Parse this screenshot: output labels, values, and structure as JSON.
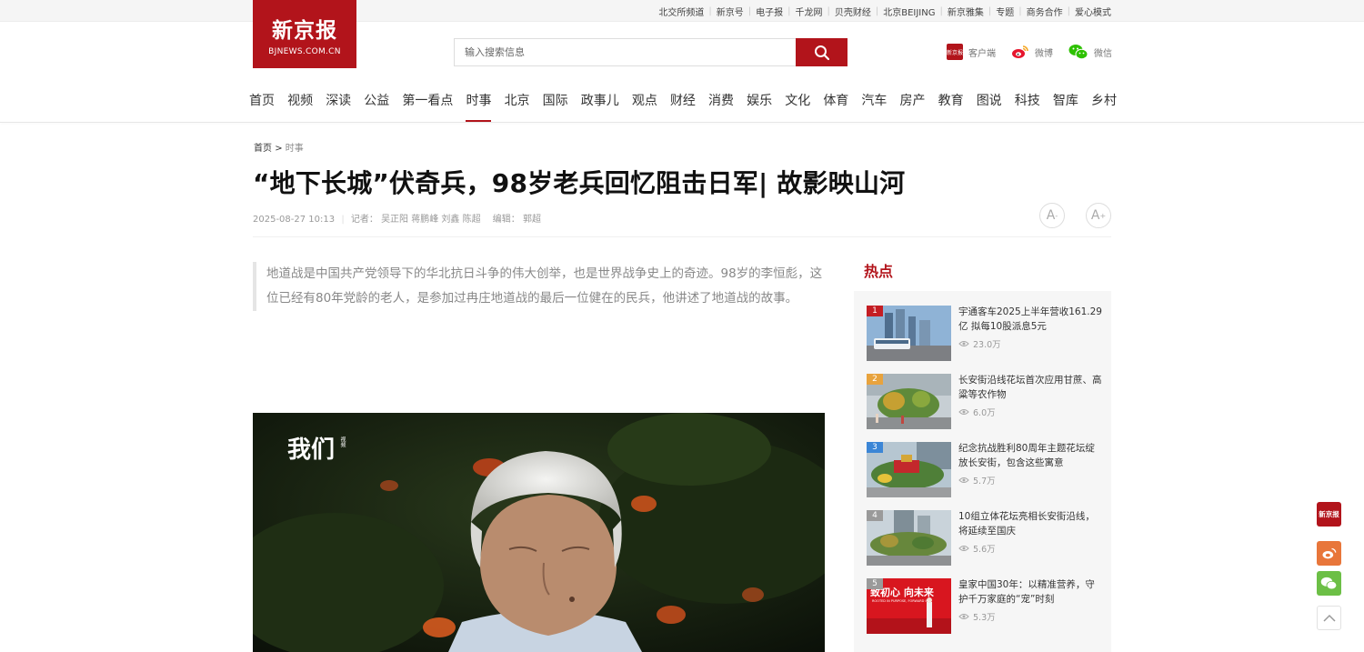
{
  "top_links": [
    "北交所频道",
    "新京号",
    "电子报",
    "千龙网",
    "贝壳财经",
    "北京BEIJING",
    "新京雅集",
    "专题",
    "商务合作",
    "爱心模式"
  ],
  "logo": {
    "name": "新京报",
    "domain": "BJNEWS.COM.CN"
  },
  "search": {
    "placeholder": "输入搜索信息"
  },
  "social": {
    "client": "客户端",
    "weibo": "微博",
    "wechat": "微信"
  },
  "nav": [
    "首页",
    "视频",
    "深读",
    "公益",
    "第一看点",
    "时事",
    "北京",
    "国际",
    "政事儿",
    "观点",
    "财经",
    "消费",
    "娱乐",
    "文化",
    "体育",
    "汽车",
    "房产",
    "教育",
    "图说",
    "科技",
    "智库",
    "乡村"
  ],
  "nav_active": "时事",
  "breadcrumb": {
    "home": "首页",
    "sep": ">",
    "current": "时事"
  },
  "article": {
    "title": "“地下长城”伏奇兵，98岁老兵回忆阻击日军| 故影映山河",
    "datetime": "2025-08-27 10:13",
    "reporters_label": "记者：",
    "reporters": "吴正阳 蒋鹏峰 刘鑫 陈超",
    "editor_label": "编辑：",
    "editor": "郭超",
    "summary": "地道战是中国共产党领导下的华北抗日斗争的伟大创举，也是世界战争史上的奇迹。98岁的李恒彪，这位已经有80年党龄的老人，是参加过冉庄地道战的最后一位健在的民兵，他讲述了地道战的故事。",
    "font_decrease": "A",
    "font_increase": "A",
    "font_minus": "-",
    "font_plus": "+"
  },
  "video": {
    "watermark": "我们",
    "watermark_small": "视频"
  },
  "hot": {
    "title": "热点",
    "items": [
      {
        "rank": "1",
        "title": "宇通客车2025上半年营收161.29亿 拟每10股派息5元",
        "views": "23.0万"
      },
      {
        "rank": "2",
        "title": "长安街沿线花坛首次应用甘蔗、高粱等农作物",
        "views": "6.0万"
      },
      {
        "rank": "3",
        "title": "纪念抗战胜利80周年主题花坛绽放长安街，包含这些寓意",
        "views": "5.7万"
      },
      {
        "rank": "4",
        "title": "10组立体花坛亮相长安街沿线，将延续至国庆",
        "views": "5.6万"
      },
      {
        "rank": "5",
        "title": "皇家中国30年：以精准营养，守护千万家庭的“宠”时刻",
        "views": "5.3万"
      }
    ],
    "thumb5_text": "致初心 向未来",
    "thumb5_sub": "ROOTED IN PURPOSE, FORWARD IN..."
  },
  "floating": {
    "logo": "新京报"
  },
  "colors": {
    "brand_red": "#b2141b",
    "weibo_orange": "#e8763a",
    "wechat_green": "#6cbf46",
    "rank1": "#c41d23",
    "rank2": "#e8a33d",
    "rank3": "#3c86d6",
    "rank_other": "#9a9a9a"
  }
}
